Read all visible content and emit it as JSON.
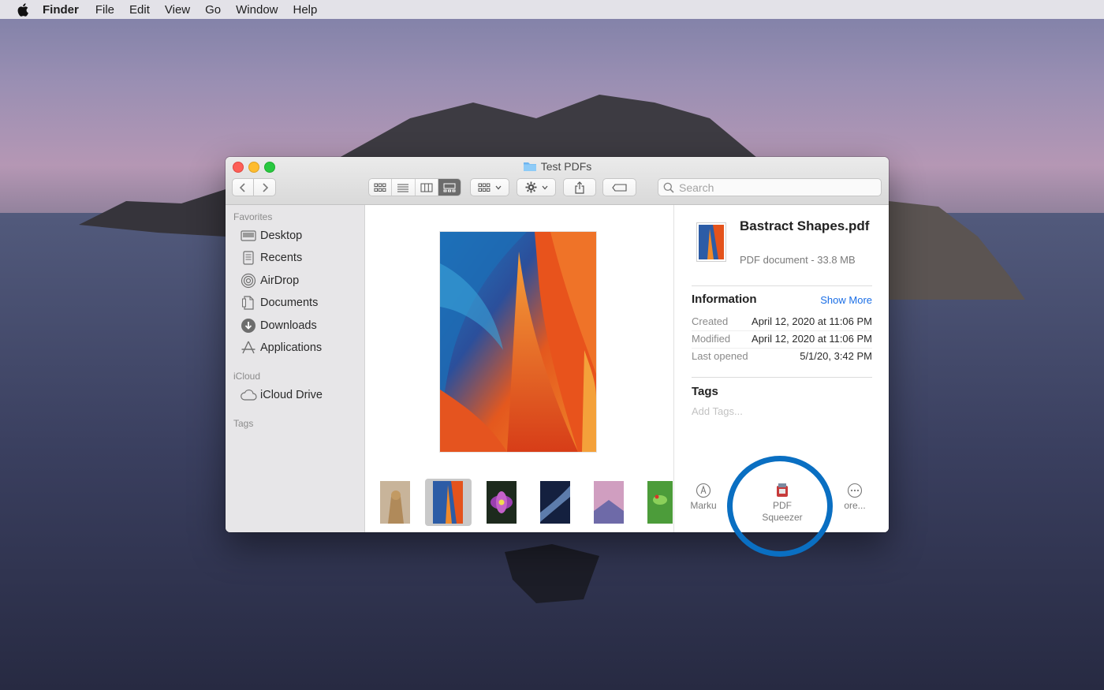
{
  "menubar": {
    "app_name": "Finder",
    "items": [
      "File",
      "Edit",
      "View",
      "Go",
      "Window",
      "Help"
    ]
  },
  "window": {
    "title": "Test PDFs",
    "search_placeholder": "Search",
    "toolbar": {
      "view_modes": [
        "icon-view",
        "list-view",
        "column-view",
        "gallery-view"
      ],
      "active_view": "gallery-view"
    }
  },
  "sidebar": {
    "favorites_header": "Favorites",
    "favorites": [
      {
        "label": "Desktop",
        "icon": "desktop-icon"
      },
      {
        "label": "Recents",
        "icon": "recents-icon"
      },
      {
        "label": "AirDrop",
        "icon": "airdrop-icon"
      },
      {
        "label": "Documents",
        "icon": "documents-icon"
      },
      {
        "label": "Downloads",
        "icon": "downloads-icon"
      },
      {
        "label": "Applications",
        "icon": "applications-icon"
      }
    ],
    "icloud_header": "iCloud",
    "icloud": [
      {
        "label": "iCloud Drive",
        "icon": "icloud-icon"
      }
    ],
    "tags_header": "Tags"
  },
  "info": {
    "file_name": "Bastract Shapes.pdf",
    "file_desc": "PDF document - 33.8 MB",
    "information_label": "Information",
    "show_more": "Show More",
    "rows": [
      {
        "key": "Created",
        "value": "April 12, 2020 at 11:06 PM"
      },
      {
        "key": "Modified",
        "value": "April 12, 2020 at 11:06 PM"
      },
      {
        "key": "Last opened",
        "value": "5/1/20, 3:42 PM"
      }
    ],
    "tags_label": "Tags",
    "add_tags": "Add Tags...",
    "actions": {
      "markup": "Marku",
      "pdf_squeezer_line1": "PDF",
      "pdf_squeezer_line2": "Squeezer",
      "more": "ore..."
    }
  },
  "colors": {
    "accent": "#1a6ee6",
    "highlight_ring": "#0a6fc2"
  }
}
